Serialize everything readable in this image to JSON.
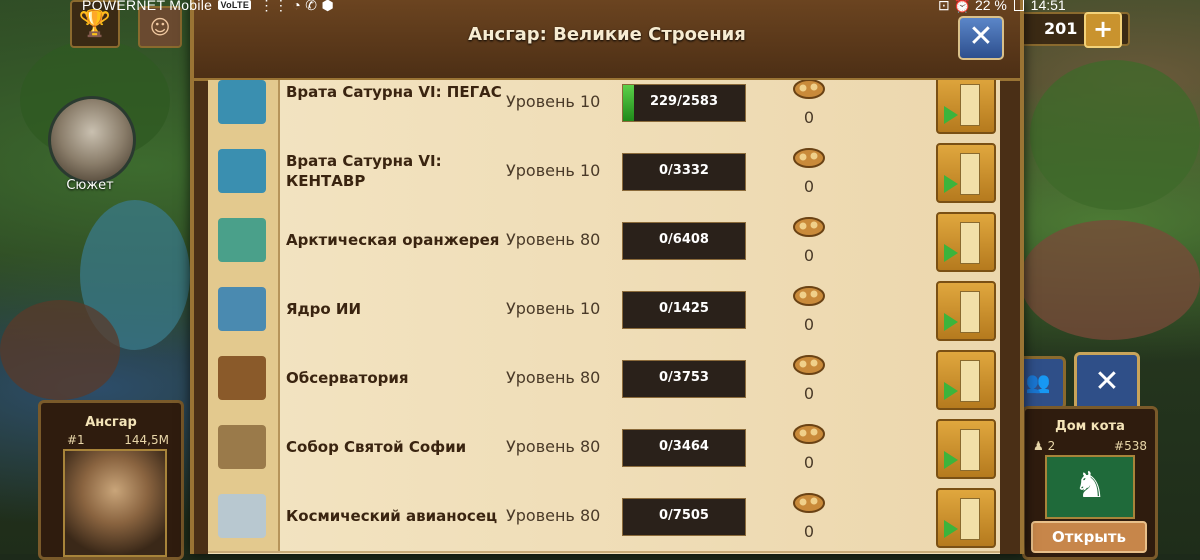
{
  "status_bar": {
    "carrier": "POWERNET Mobile",
    "volte": "VoLTE",
    "right_text": "22 %",
    "time": "14:51"
  },
  "hud_left": {
    "story_label": "Сюжет",
    "player": {
      "name": "Ансгар",
      "rank": "#1",
      "score": "144,5M"
    }
  },
  "hud_right": {
    "coins": "201",
    "plus": "+",
    "close": "✕",
    "guild": {
      "title": "Дом кота",
      "members": "2",
      "rank": "#538",
      "open_label": "Открыть"
    }
  },
  "modal": {
    "title": "Ансгар: Великие Строения",
    "close_label": "✕",
    "rows": [
      {
        "name": "Врата Сатурна VI: ПЕГАС",
        "level": "Уровень 10",
        "progress": "229/2583",
        "fill": 0.089,
        "fp": "0",
        "color": "#3a8fb0"
      },
      {
        "name": "Врата Сатурна VI: КЕНТАВР",
        "level": "Уровень 10",
        "progress": "0/3332",
        "fill": 0,
        "fp": "0",
        "color": "#3a8fb0"
      },
      {
        "name": "Арктическая оранжерея",
        "level": "Уровень 80",
        "progress": "0/6408",
        "fill": 0,
        "fp": "0",
        "color": "#4aa08a"
      },
      {
        "name": "Ядро ИИ",
        "level": "Уровень 10",
        "progress": "0/1425",
        "fill": 0,
        "fp": "0",
        "color": "#4a8ab0"
      },
      {
        "name": "Обсерватория",
        "level": "Уровень 80",
        "progress": "0/3753",
        "fill": 0,
        "fp": "0",
        "color": "#8a5a2a"
      },
      {
        "name": "Собор Святой Софии",
        "level": "Уровень 80",
        "progress": "0/3464",
        "fill": 0,
        "fp": "0",
        "color": "#9a7a4a"
      },
      {
        "name": "Космический авианосец",
        "level": "Уровень 80",
        "progress": "0/7505",
        "fill": 0,
        "fp": "0",
        "color": "#b8c8d0"
      }
    ]
  }
}
